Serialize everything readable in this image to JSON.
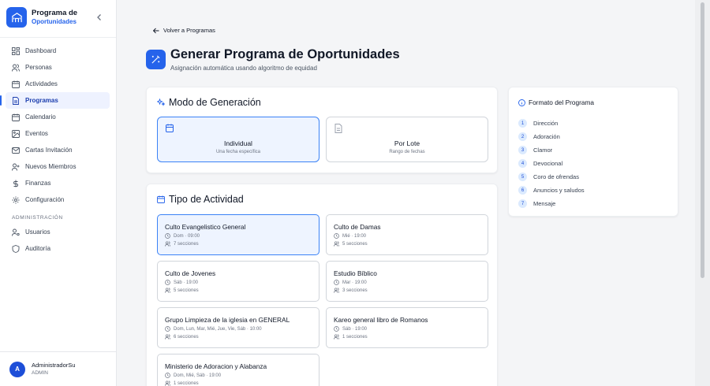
{
  "sidebar": {
    "brand_line1": "Programa de",
    "brand_line2": "Oportunidades",
    "items": [
      {
        "label": "Dashboard",
        "icon": "grid-icon"
      },
      {
        "label": "Personas",
        "icon": "users-icon"
      },
      {
        "label": "Actividades",
        "icon": "calendar-icon"
      },
      {
        "label": "Programas",
        "icon": "document-icon",
        "active": true
      },
      {
        "label": "Calendario",
        "icon": "calendar-icon"
      },
      {
        "label": "Eventos",
        "icon": "image-icon"
      },
      {
        "label": "Cartas Invitación",
        "icon": "mail-icon"
      },
      {
        "label": "Nuevos Miembros",
        "icon": "user-plus-icon"
      },
      {
        "label": "Finanzas",
        "icon": "dollar-icon"
      },
      {
        "label": "Configuración",
        "icon": "gear-icon"
      }
    ],
    "admin_section": "ADMINISTRACIÓN",
    "admin_items": [
      {
        "label": "Usuarios",
        "icon": "user-cog-icon"
      },
      {
        "label": "Auditoría",
        "icon": "shield-icon"
      }
    ],
    "user": {
      "initial": "A",
      "name": "AdministradorSu",
      "role": "ADMIN"
    }
  },
  "main": {
    "back_label": "Volver a Programas",
    "title": "Generar Programa de Oportunidades",
    "subtitle": "Asignación automática usando algoritmo de equidad",
    "mode": {
      "heading": "Modo de Generación",
      "options": [
        {
          "title": "Individual",
          "sub": "Una fecha específica",
          "selected": true
        },
        {
          "title": "Por Lote",
          "sub": "Rango de fechas",
          "selected": false
        }
      ]
    },
    "activity": {
      "heading": "Tipo de Actividad",
      "items": [
        {
          "name": "Culto Evangelistico General",
          "schedule": "Dom · 09:00",
          "sections": "7 secciones",
          "selected": true
        },
        {
          "name": "Culto de Damas",
          "schedule": "Mié · 19:00",
          "sections": "5 secciones"
        },
        {
          "name": "Culto de Jovenes",
          "schedule": "Sáb · 19:00",
          "sections": "5 secciones"
        },
        {
          "name": "Estudio Bíblico",
          "schedule": "Mar · 19:00",
          "sections": "3 secciones"
        },
        {
          "name": "Grupo Limpieza de la iglesia en GENERAL",
          "schedule": "Dom, Lun, Mar, Mié, Jue, Vie, Sáb · 10:00",
          "sections": "6 secciones"
        },
        {
          "name": "Kareo general libro de Romanos",
          "schedule": "Sáb · 19:00",
          "sections": "1 secciones"
        },
        {
          "name": "Ministerio de Adoracion y Alabanza",
          "schedule": "Dom, Mié, Sáb · 19:00",
          "sections": "1 secciones"
        }
      ]
    },
    "format": {
      "heading": "Formato del Programa",
      "items": [
        "Dirección",
        "Adoración",
        "Clamor",
        "Devocional",
        "Coro de ofrendas",
        "Anuncios y saludos",
        "Mensaje"
      ]
    }
  },
  "colors": {
    "accent": "#2563eb",
    "selected_bg": "#eef4ff"
  }
}
